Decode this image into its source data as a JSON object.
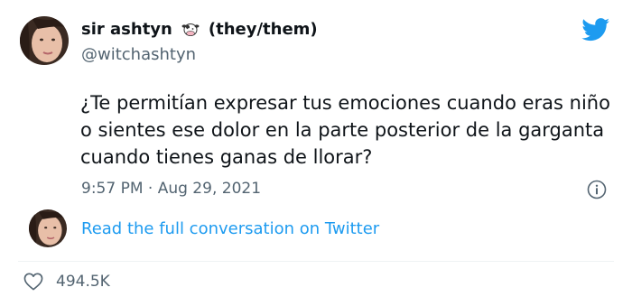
{
  "tweet": {
    "author": {
      "display_name": "sir ashtyn",
      "pronouns": "(they/them)",
      "handle": "@witchashtyn",
      "emoji_icon": "cow-face-icon"
    },
    "text": "¿Te permitían expresar tus emociones cuando eras niño o sientes ese dolor en la parte posterior de la garganta cuando tienes ganas de llorar?",
    "timestamp": "9:57 PM · Aug 29, 2021",
    "conversation_link": "Read the full conversation on Twitter",
    "likes": "494.5K"
  },
  "icons": {
    "brand": "twitter-bird-icon",
    "info": "info-icon",
    "like": "heart-icon"
  },
  "colors": {
    "brand": "#1d9bf0",
    "text": "#0f1419",
    "secondary": "#536471"
  }
}
